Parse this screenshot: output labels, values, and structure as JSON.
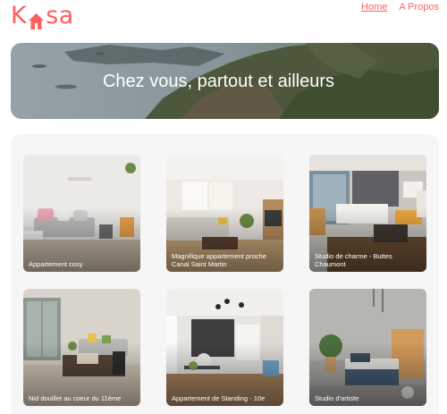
{
  "brand": {
    "logo_text_k": "K",
    "logo_text_rest": "sa",
    "color": "#FF6060"
  },
  "nav": {
    "home": "Home",
    "about": "A Propos"
  },
  "banner": {
    "title": "Chez vous, partout et ailleurs"
  },
  "listings": [
    {
      "title": "Appartement cosy"
    },
    {
      "title": "Magnifique appartement proche Canal Saint Martin"
    },
    {
      "title": "Studio de charme - Buttes Chaumont"
    },
    {
      "title": "Nid douillet au coeur du 11ème"
    },
    {
      "title": "Appartement de Standing - 10e"
    },
    {
      "title": "Studio d'artiste"
    }
  ]
}
